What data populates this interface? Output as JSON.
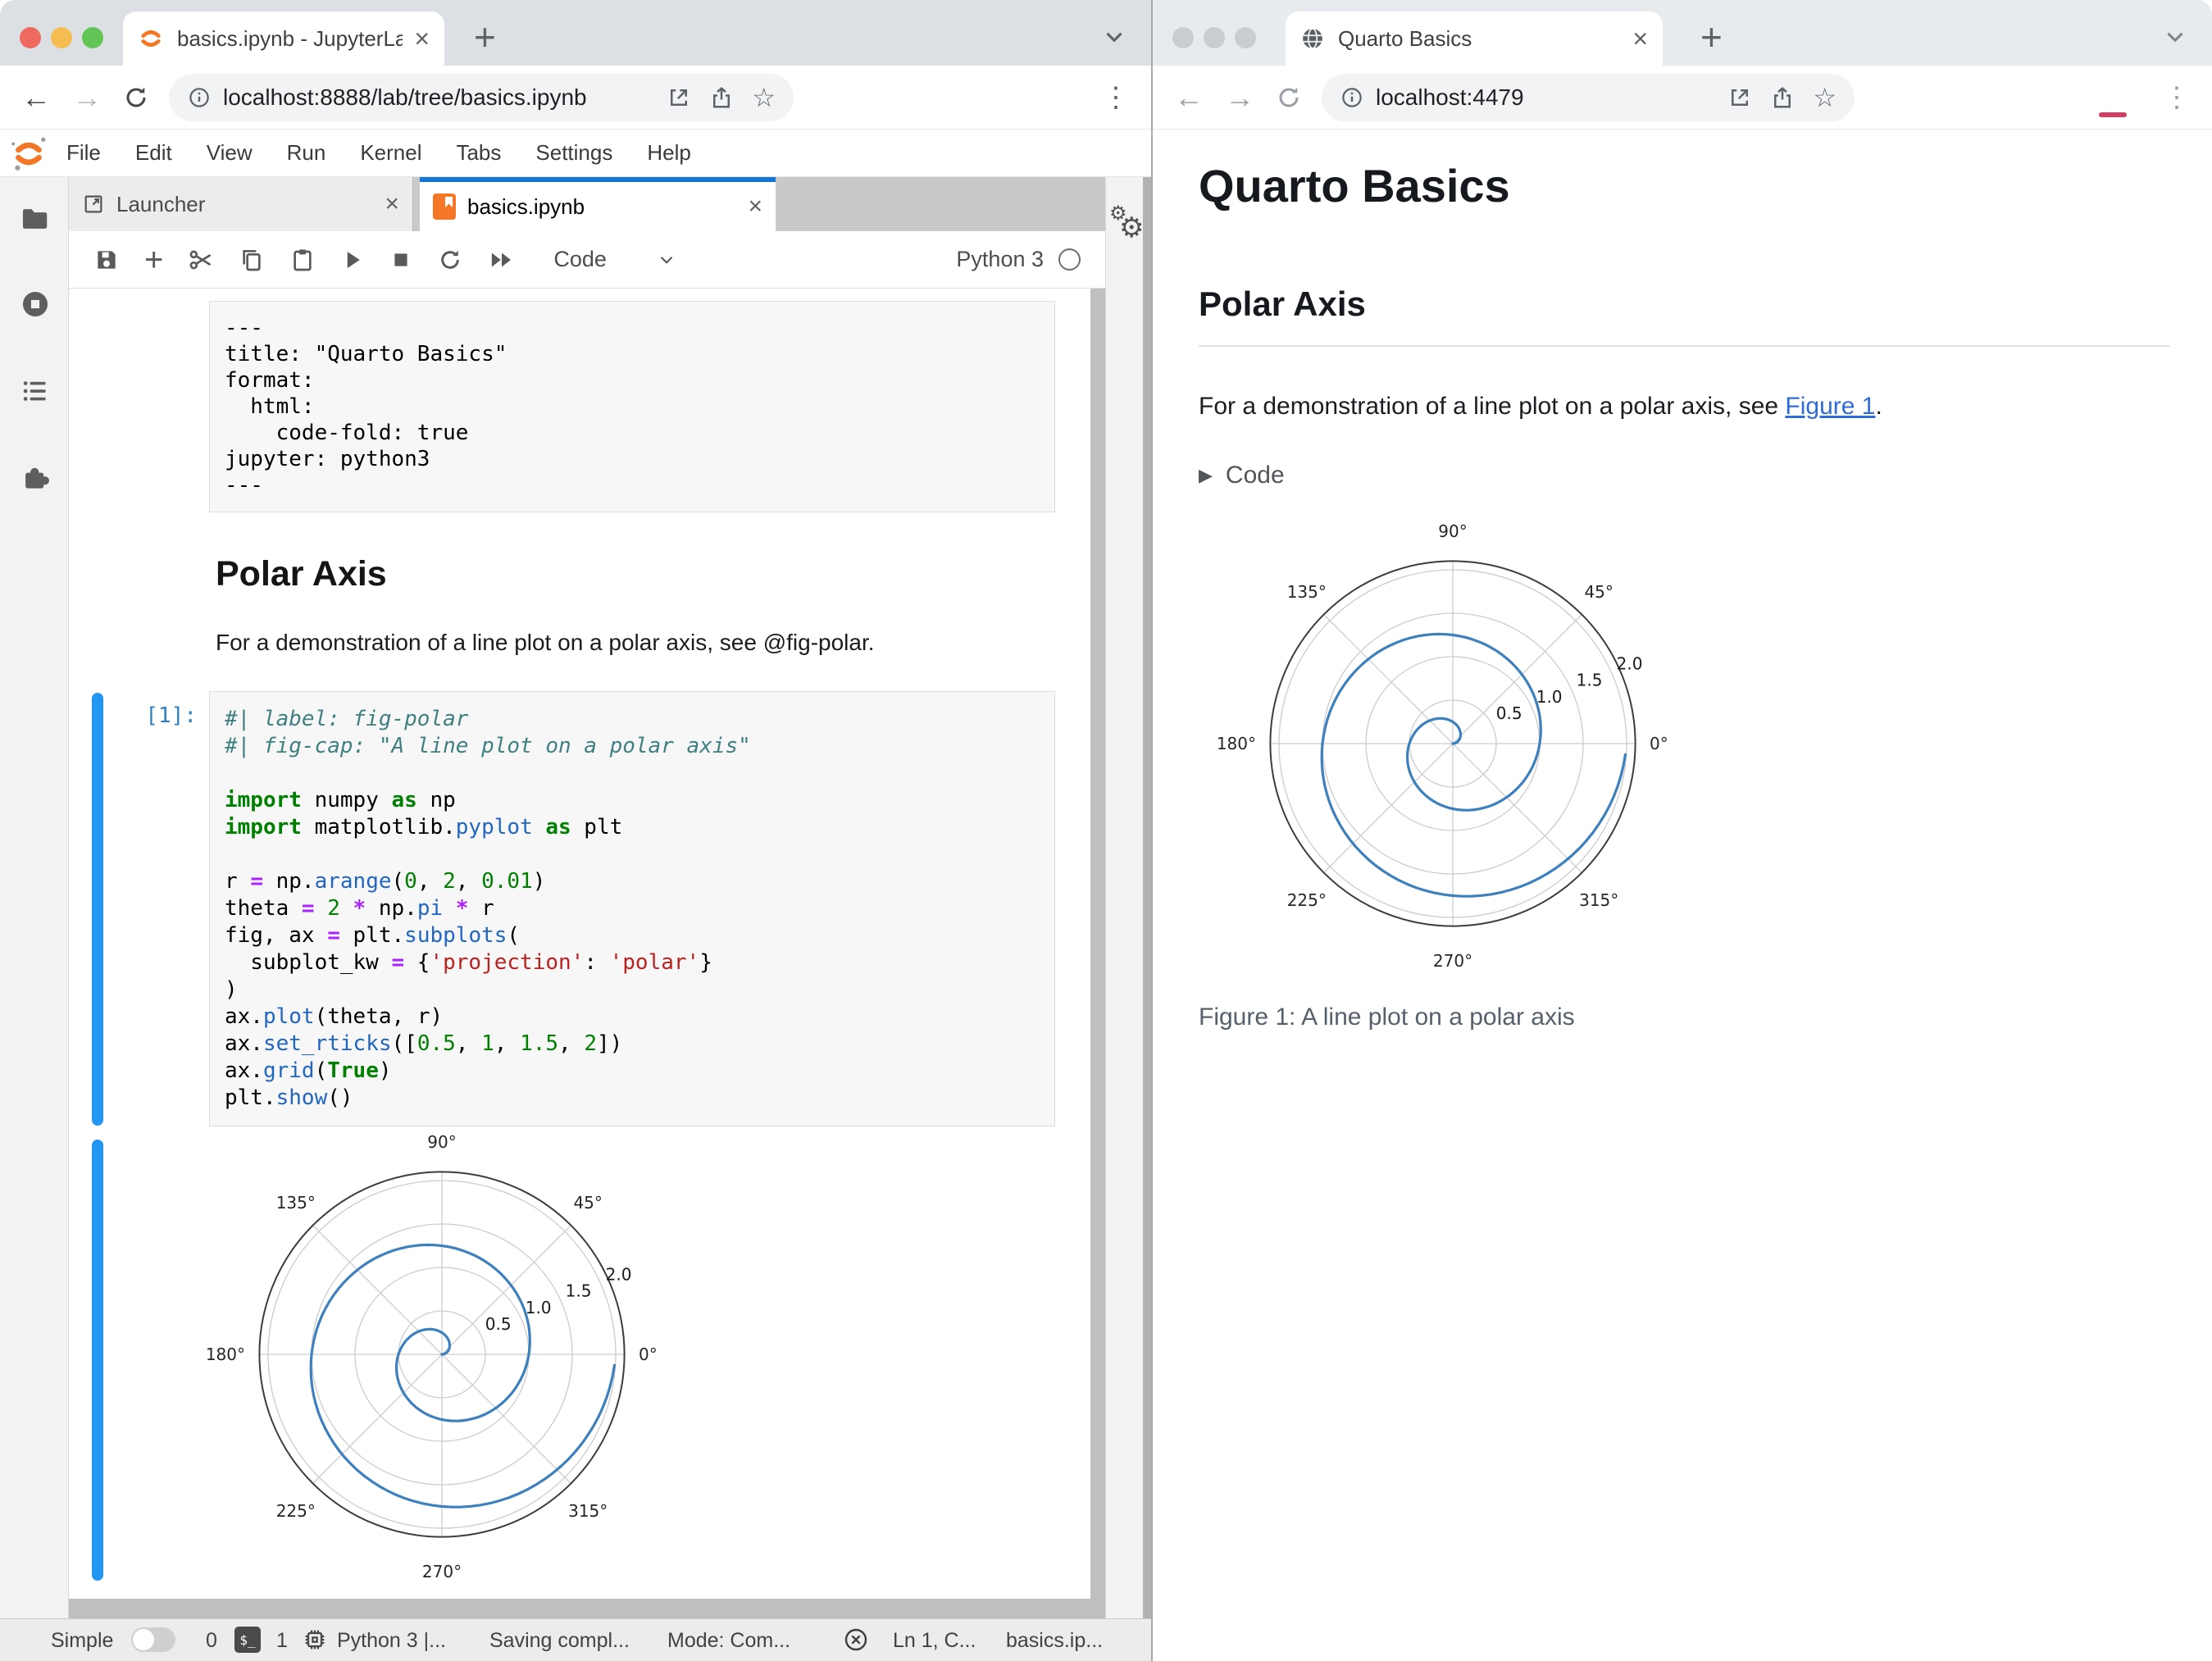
{
  "chrome_left": {
    "tab_title": "basics.ipynb - JupyterLab",
    "url": "localhost:8888/lab/tree/basics.ipynb",
    "menu_items": [
      "File",
      "Edit",
      "View",
      "Run",
      "Kernel",
      "Tabs",
      "Settings",
      "Help"
    ]
  },
  "jupyterlab": {
    "doc_tabs": {
      "launcher": "Launcher",
      "notebook": "basics.ipynb"
    },
    "toolbar": {
      "cell_type": "Code",
      "kernel_name": "Python 3"
    },
    "yaml_cell": {
      "lines": [
        "---",
        "title: \"Quarto Basics\"",
        "format:",
        "  html:",
        "    code-fold: true",
        "jupyter: python3",
        "---"
      ]
    },
    "markdown": {
      "heading": "Polar Axis",
      "paragraph": "For a demonstration of a line plot on a polar axis, see @fig-polar."
    },
    "code_cell": {
      "prompt": "[1]:",
      "lines": [
        [
          [
            "c",
            "#| label: fig-polar"
          ]
        ],
        [
          [
            "c",
            "#| fig-cap: \"A line plot on a polar axis\""
          ]
        ],
        [],
        [
          [
            "k",
            "import"
          ],
          [
            "t",
            " numpy "
          ],
          [
            "k",
            "as"
          ],
          [
            "t",
            " np"
          ]
        ],
        [
          [
            "k",
            "import"
          ],
          [
            "t",
            " matplotlib."
          ],
          [
            "p",
            "pyplot"
          ],
          [
            "t",
            " "
          ],
          [
            "k",
            "as"
          ],
          [
            "t",
            " plt"
          ]
        ],
        [],
        [
          [
            "t",
            "r "
          ],
          [
            "o",
            "="
          ],
          [
            "t",
            " np."
          ],
          [
            "p",
            "arange"
          ],
          [
            "t",
            "("
          ],
          [
            "n",
            "0"
          ],
          [
            "t",
            ", "
          ],
          [
            "n",
            "2"
          ],
          [
            "t",
            ", "
          ],
          [
            "n",
            "0.01"
          ],
          [
            "t",
            ")"
          ]
        ],
        [
          [
            "t",
            "theta "
          ],
          [
            "o",
            "="
          ],
          [
            "t",
            " "
          ],
          [
            "n",
            "2"
          ],
          [
            "t",
            " "
          ],
          [
            "o",
            "*"
          ],
          [
            "t",
            " np."
          ],
          [
            "p",
            "pi"
          ],
          [
            "t",
            " "
          ],
          [
            "o",
            "*"
          ],
          [
            "t",
            " r"
          ]
        ],
        [
          [
            "t",
            "fig, ax "
          ],
          [
            "o",
            "="
          ],
          [
            "t",
            " plt."
          ],
          [
            "p",
            "subplots"
          ],
          [
            "t",
            "("
          ]
        ],
        [
          [
            "t",
            "  subplot_kw "
          ],
          [
            "o",
            "="
          ],
          [
            "t",
            " {"
          ],
          [
            "s",
            "'projection'"
          ],
          [
            "t",
            ": "
          ],
          [
            "s",
            "'polar'"
          ],
          [
            "t",
            "}"
          ]
        ],
        [
          [
            "t",
            ")"
          ]
        ],
        [
          [
            "t",
            "ax."
          ],
          [
            "p",
            "plot"
          ],
          [
            "t",
            "(theta, r)"
          ]
        ],
        [
          [
            "t",
            "ax."
          ],
          [
            "p",
            "set_rticks"
          ],
          [
            "t",
            "(["
          ],
          [
            "n",
            "0.5"
          ],
          [
            "t",
            ", "
          ],
          [
            "n",
            "1"
          ],
          [
            "t",
            ", "
          ],
          [
            "n",
            "1.5"
          ],
          [
            "t",
            ", "
          ],
          [
            "n",
            "2"
          ],
          [
            "t",
            "])"
          ]
        ],
        [
          [
            "t",
            "ax."
          ],
          [
            "p",
            "grid"
          ],
          [
            "t",
            "("
          ],
          [
            "k",
            "True"
          ],
          [
            "t",
            ")"
          ]
        ],
        [
          [
            "t",
            "plt."
          ],
          [
            "p",
            "show"
          ],
          [
            "t",
            "()"
          ]
        ]
      ]
    },
    "statusbar": {
      "simple_label": "Simple",
      "terminal_count": "0",
      "terminal_badge": "$_",
      "kernel_count": "1",
      "kernel_text": "Python 3 |...",
      "saving_text": "Saving compl...",
      "mode_text": "Mode: Com...",
      "line_col_text": "Ln 1, C...",
      "file_text": "basics.ip..."
    }
  },
  "chrome_right": {
    "tab_title": "Quarto Basics",
    "url": "localhost:4479"
  },
  "quarto_page": {
    "title": "Quarto Basics",
    "section": "Polar Axis",
    "paragraph_before_link": "For a demonstration of a line plot on a polar axis, see ",
    "link_text": "Figure 1",
    "paragraph_after_link": ".",
    "code_toggle_label": "Code",
    "caption": "Figure 1: A line plot on a polar axis"
  },
  "icons": {
    "left_sidebar": [
      "folder-icon",
      "running-kernels-icon",
      "table-of-contents-icon",
      "extensions-puzzle-icon"
    ],
    "notebook_toolbar": [
      "save-icon",
      "add-cell-icon",
      "cut-icon",
      "copy-icon",
      "paste-icon",
      "run-icon",
      "stop-icon",
      "restart-kernel-icon",
      "fast-forward-icon"
    ],
    "colors": {
      "jupyter_orange": "#f37726",
      "active_tab_blue": "#1976d2",
      "collapser_blue": "#2196f3",
      "prompt_blue": "#307fc1",
      "quarto_link_blue": "#2f6bdb"
    }
  },
  "chart_data": {
    "type": "line",
    "projection": "polar",
    "title": "",
    "series": [
      {
        "name": "r",
        "theta_formula": "theta = 2*pi*r",
        "r_start": 0,
        "r_end": 2,
        "r_step": 0.01,
        "color": "#3d80be"
      }
    ],
    "angle_ticks_deg": [
      0,
      45,
      90,
      135,
      180,
      225,
      270,
      315
    ],
    "angle_tick_labels": [
      "0°",
      "45°",
      "90°",
      "135°",
      "180°",
      "225°",
      "270°",
      "315°"
    ],
    "r_ticks": [
      0.5,
      1.0,
      1.5,
      2.0
    ],
    "r_tick_labels": [
      "0.5",
      "1.0",
      "1.5",
      "2.0"
    ],
    "r_max": 2.1,
    "rlabel_angle_deg": 22.5,
    "grid": true,
    "grid_color": "#cccccc",
    "spine_color": "#3c3c3c"
  }
}
